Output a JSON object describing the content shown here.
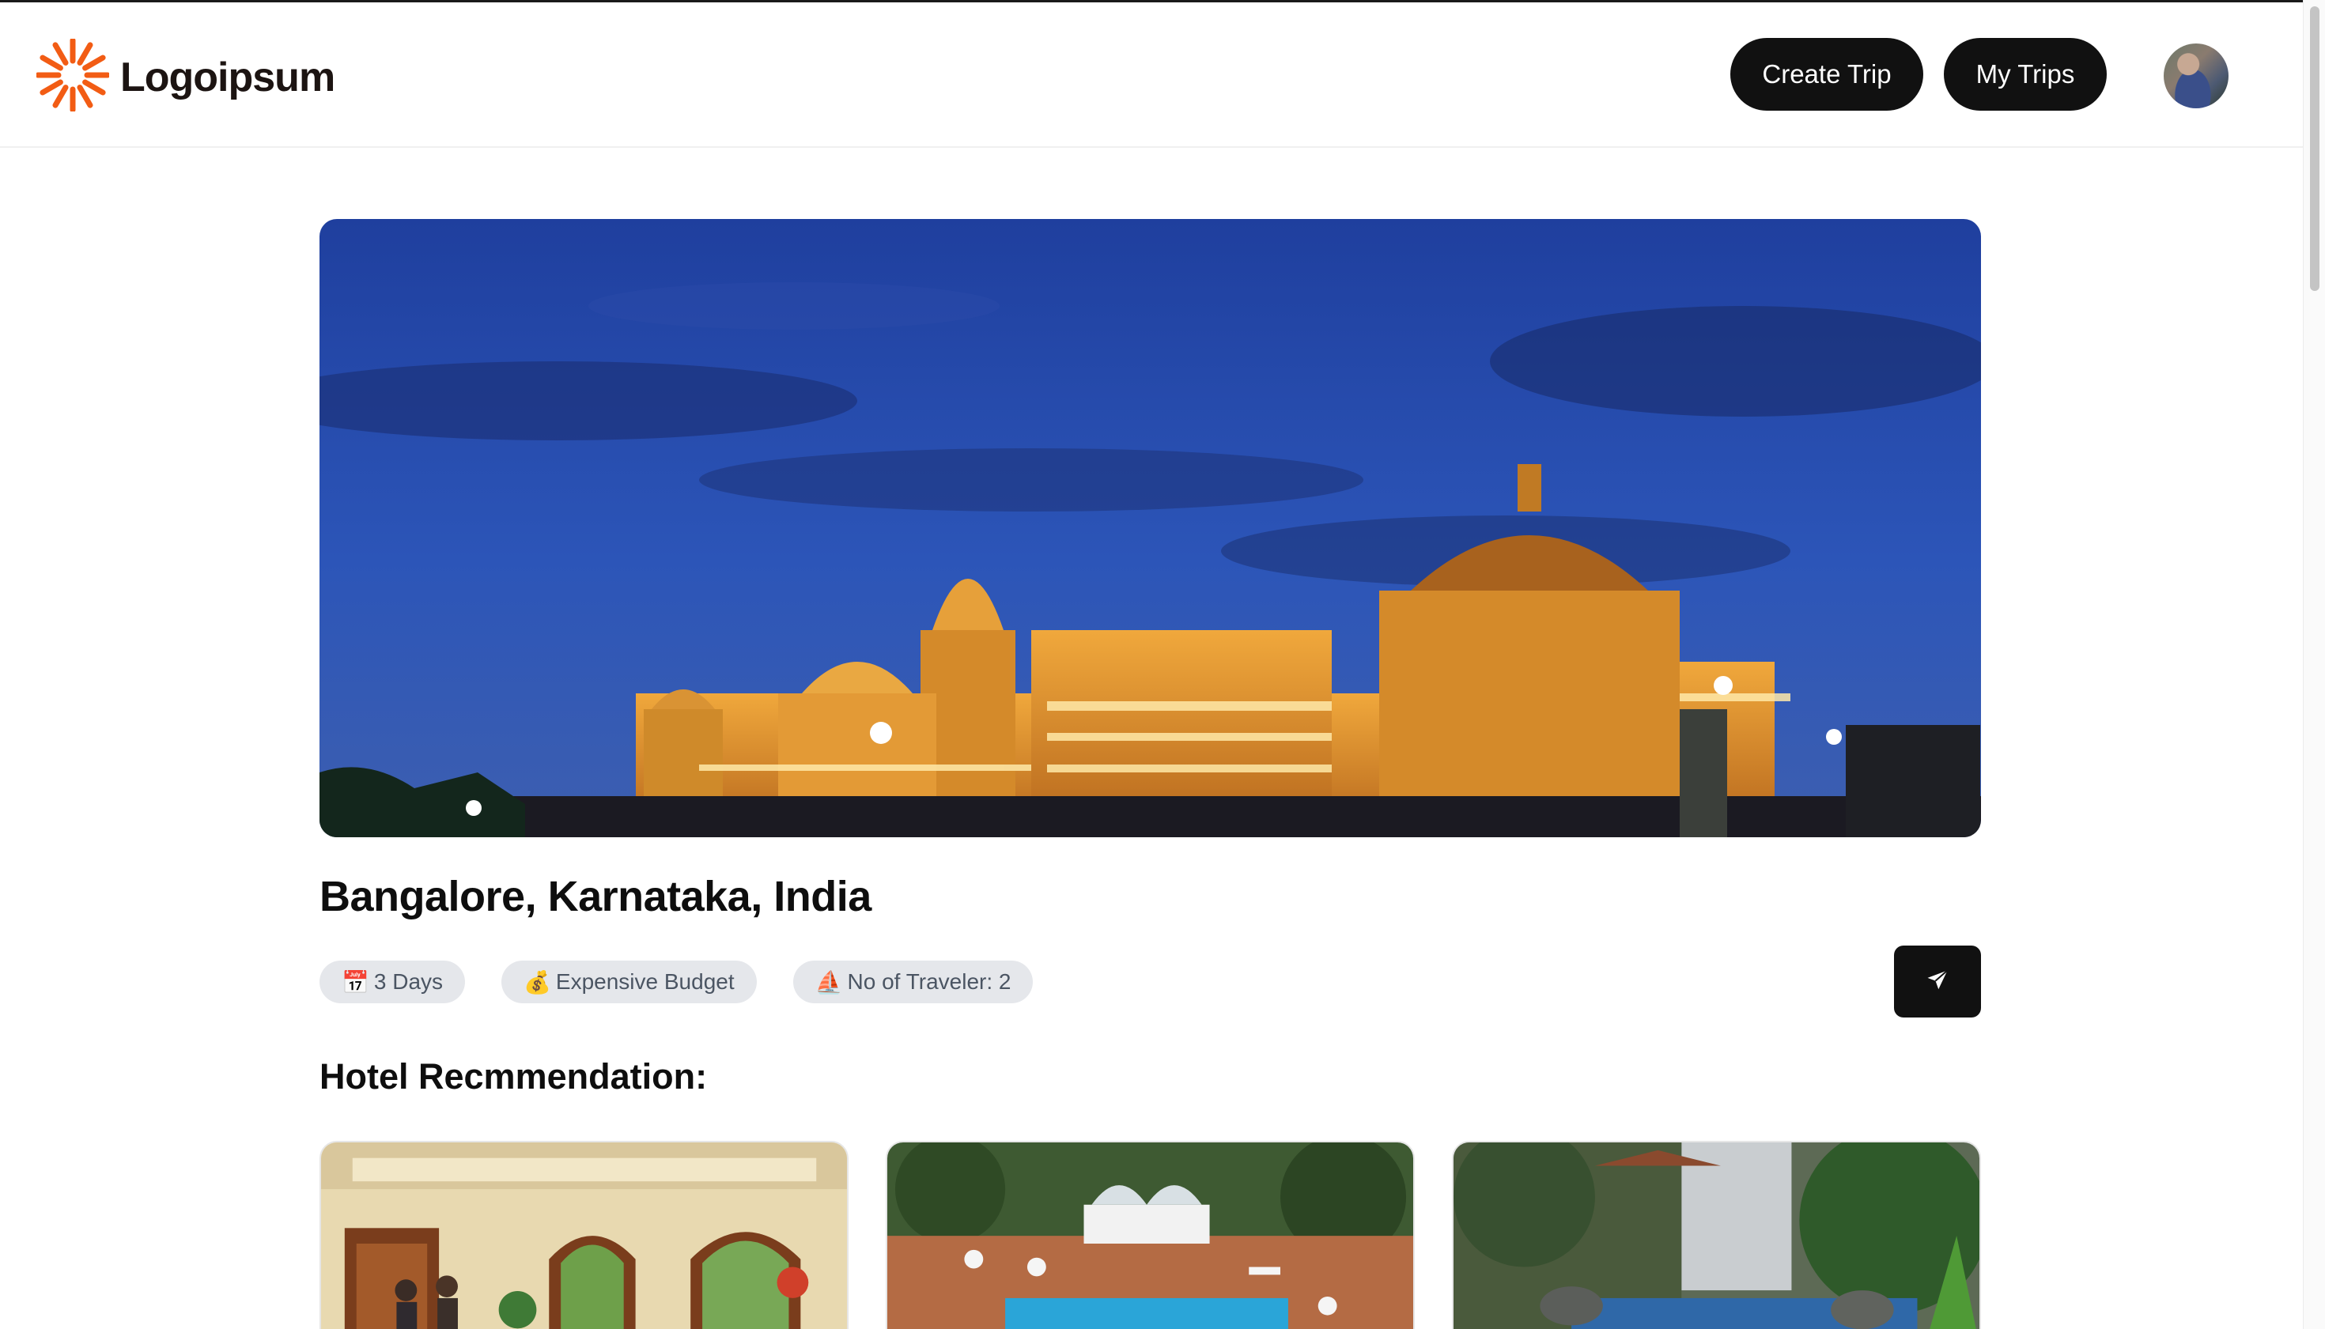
{
  "brand": {
    "name": "Logoipsum",
    "logo_icon": "sunburst-logo-icon",
    "accent": "#f25c14"
  },
  "nav": {
    "create_trip": "Create Trip",
    "my_trips": "My Trips",
    "avatar": "user-avatar"
  },
  "trip": {
    "destination": "Bangalore, Karnataka, India",
    "hero_image": "illuminated palace at dusk",
    "chips": [
      {
        "icon": "📅",
        "label": "3 Days"
      },
      {
        "icon": "💰",
        "label": "Expensive Budget"
      },
      {
        "icon": "⛵",
        "label": "No of Traveler: 2"
      }
    ],
    "share_icon": "send-icon"
  },
  "hotels": {
    "title": "Hotel Recmmendation:",
    "items": [
      {
        "image": "hotel lobby interior"
      },
      {
        "image": "hotel pool with domes"
      },
      {
        "image": "hotel pool with greenery"
      }
    ]
  },
  "colors": {
    "button_bg": "#111111",
    "chip_bg": "#e5e7eb",
    "chip_text": "#4b5563"
  }
}
